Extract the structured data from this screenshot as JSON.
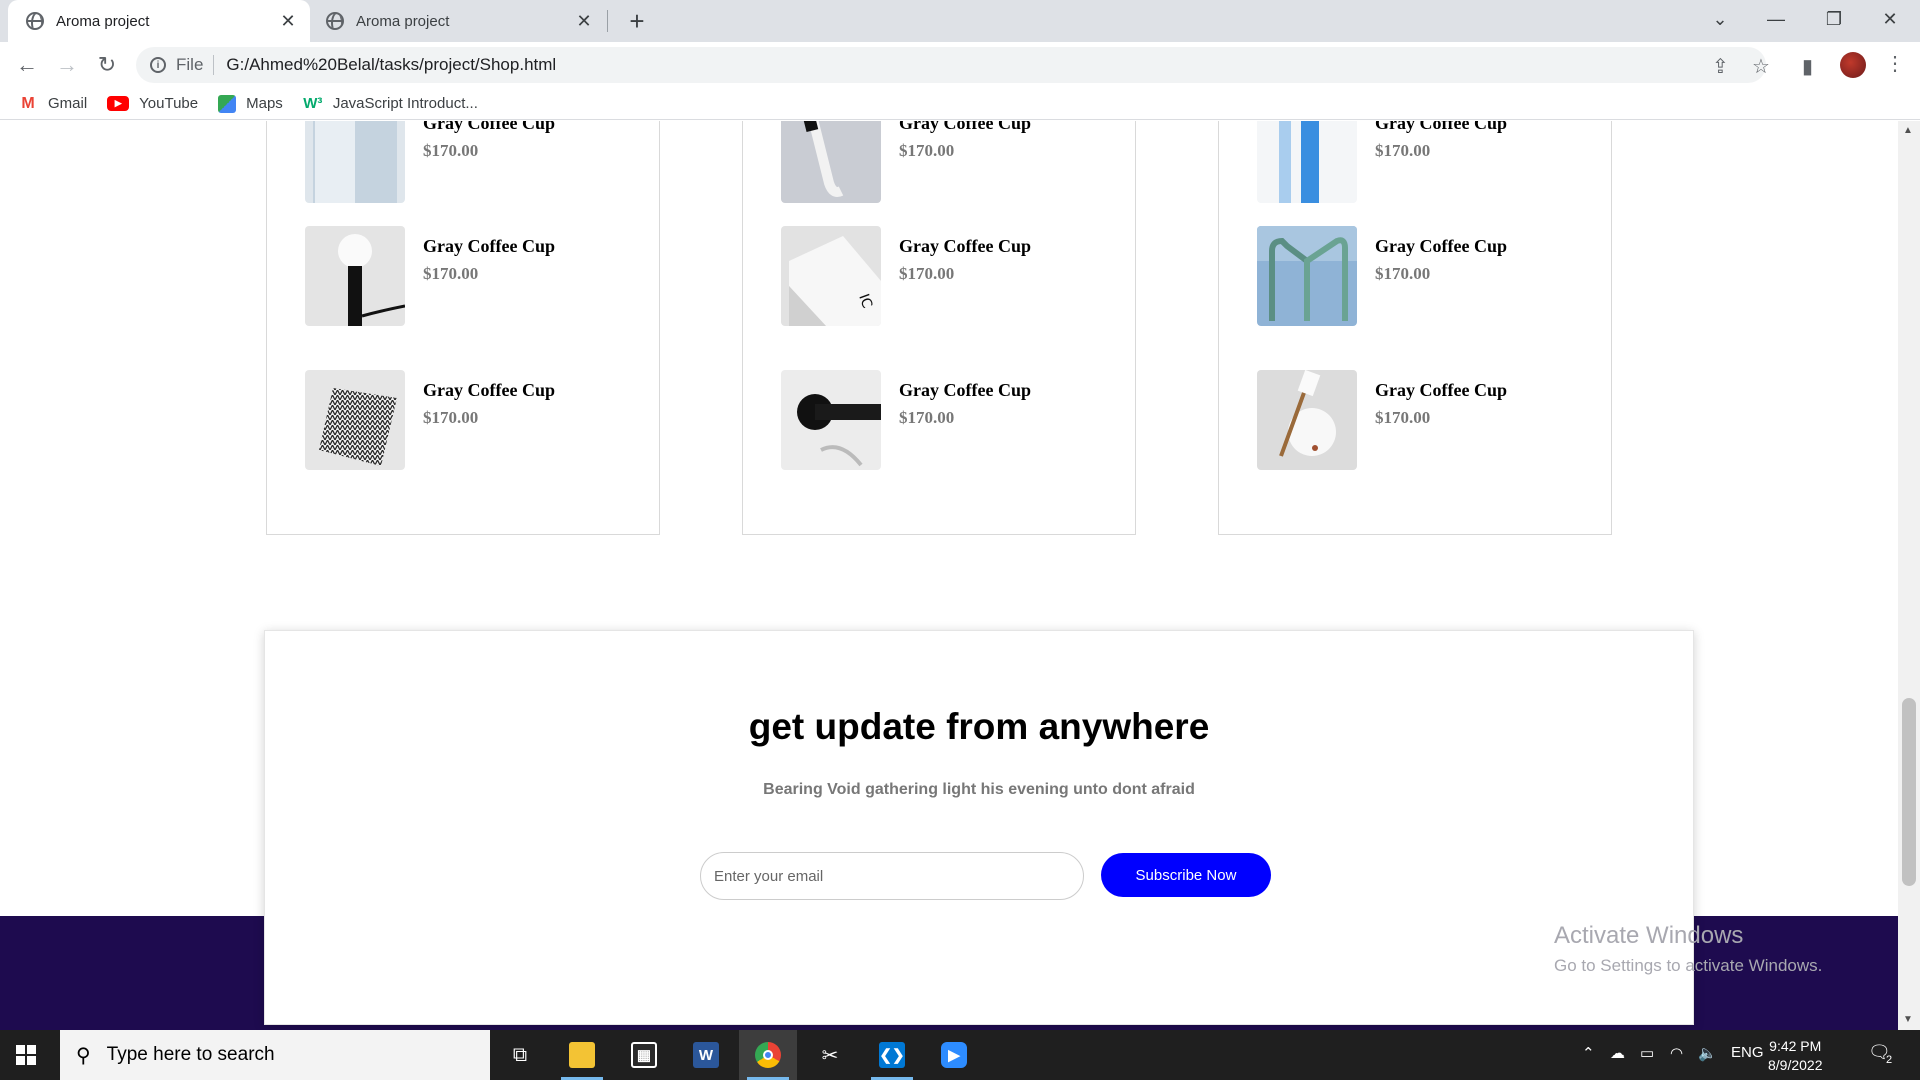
{
  "browser": {
    "tabs": [
      {
        "title": "Aroma project",
        "active": true
      },
      {
        "title": "Aroma project",
        "active": false
      }
    ],
    "address": {
      "scheme_label": "File",
      "url": "G:/Ahmed%20Belal/tasks/project/Shop.html"
    },
    "bookmarks": [
      {
        "label": "Gmail",
        "icon": "gmail-icon"
      },
      {
        "label": "YouTube",
        "icon": "youtube-icon"
      },
      {
        "label": "Maps",
        "icon": "maps-icon"
      },
      {
        "label": "JavaScript Introduct...",
        "icon": "w3schools-icon"
      }
    ]
  },
  "products": {
    "columns": [
      {
        "items": [
          {
            "name": "Gray Coffee Cup",
            "price": "$170.00",
            "image": "white-cup"
          },
          {
            "name": "Gray Coffee Cup",
            "price": "$170.00",
            "image": "black-lamp"
          },
          {
            "name": "Gray Coffee Cup",
            "price": "$170.00",
            "image": "patterned-cloth"
          }
        ]
      },
      {
        "items": [
          {
            "name": "Gray Coffee Cup",
            "price": "$170.00",
            "image": "toothbrush"
          },
          {
            "name": "Gray Coffee Cup",
            "price": "$170.00",
            "image": "white-package"
          },
          {
            "name": "Gray Coffee Cup",
            "price": "$170.00",
            "image": "black-hook"
          }
        ]
      },
      {
        "items": [
          {
            "name": "Gray Coffee Cup",
            "price": "$170.00",
            "image": "blue-tube"
          },
          {
            "name": "Gray Coffee Cup",
            "price": "$170.00",
            "image": "glass-frame"
          },
          {
            "name": "Gray Coffee Cup",
            "price": "$170.00",
            "image": "white-sphere"
          }
        ]
      }
    ]
  },
  "newsletter": {
    "title": "get update from anywhere",
    "subtitle": "Bearing Void gathering light his evening unto dont afraid",
    "email_placeholder": "Enter your email",
    "button_label": "Subscribe Now"
  },
  "watermark": {
    "line1": "Activate Windows",
    "line2": "Go to Settings to activate Windows."
  },
  "taskbar": {
    "search_placeholder": "Type here to search",
    "language": "ENG",
    "time": "9:42 PM",
    "date": "8/9/2022",
    "notification_count": "2"
  },
  "colors": {
    "subscribe_button": "#0000ff",
    "footer_band": "#1e0b4f",
    "price_text": "#777777"
  }
}
